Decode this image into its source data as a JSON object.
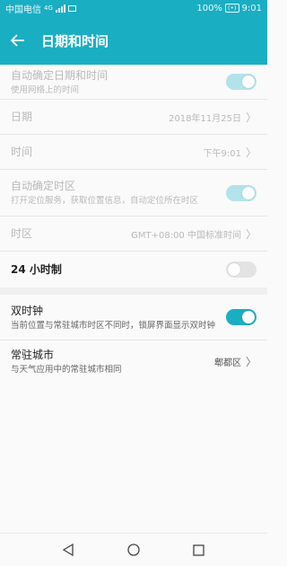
{
  "status_bar": {
    "carrier": "中国电信",
    "network": "4G",
    "battery_percent": "100%",
    "battery_icon_text": "(•)",
    "time": "9:01"
  },
  "app_bar": {
    "title": "日期和时间"
  },
  "settings": {
    "auto_datetime": {
      "title": "自动确定日期和时间",
      "subtitle": "使用网络上的时间",
      "enabled": true,
      "disabled": true
    },
    "date": {
      "title": "日期",
      "value": "2018年11月25日"
    },
    "time": {
      "title": "时间",
      "value": "下午9:01"
    },
    "auto_timezone": {
      "title": "自动确定时区",
      "subtitle": "打开定位服务，获取位置信息，自动定位所在时区",
      "enabled": true,
      "disabled": true
    },
    "timezone": {
      "title": "时区",
      "value": "GMT+08:00 中国标准时间"
    },
    "hour24": {
      "title": "24 小时制",
      "enabled": false
    },
    "dual_clock": {
      "title": "双时钟",
      "subtitle": "当前位置与常驻城市时区不同时，锁屏界面显示双时钟",
      "enabled": true
    },
    "home_city": {
      "title": "常驻城市",
      "subtitle": "与天气应用中的常驻城市相同",
      "value": "郫都区"
    }
  },
  "colors": {
    "accent": "#1aaec2",
    "accent_dim": "#b2e3ea",
    "toggle_off": "#e3e3e3"
  },
  "icons": {
    "back": "arrow-left-icon",
    "chevron": "chevron-right-icon",
    "nav_back": "triangle-back-icon",
    "nav_home": "circle-home-icon",
    "nav_recent": "square-recent-icon"
  }
}
